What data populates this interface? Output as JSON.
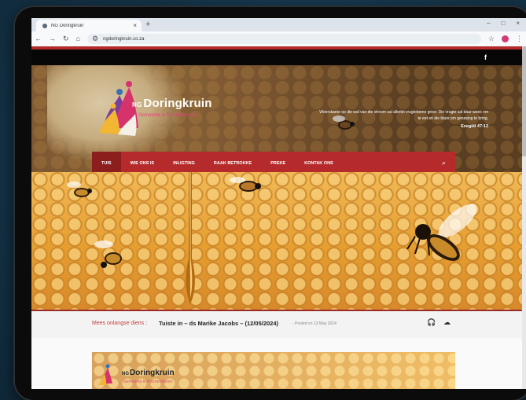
{
  "browser": {
    "tab_title": "NG Doringkruin",
    "url": "ngdoringkruin.co.za",
    "new_tab": "+",
    "tab_close": "×",
    "window_controls": [
      "–",
      "□",
      "×"
    ]
  },
  "site": {
    "facebook": "f",
    "logo_ng": "NG",
    "logo_name": "Doringkruin",
    "logo_subtitle": "Gemeente in Potchefstroom",
    "verse_text": "Weerskante op die wal van die stroom sal allerlei vrugtebome groei. Die vrugte sal daar wees om te eet en die blare om genesing te bring.",
    "verse_ref": "Esegiël 47:12",
    "nav": [
      "TUIS",
      "WIE ONS IS",
      "INLIGTING",
      "RAAK BETROKKE",
      "PREKE",
      "KONTAK ONS"
    ],
    "latest_label": "Mees onlangse diens :",
    "latest_title": "Tuiste in – ds Marike Jacobs – (12/05/2024)",
    "latest_date": "- Posted on 13 May 2024",
    "card_logo_ng": "NG",
    "card_logo_name": "Doringkruin",
    "card_logo_subtitle": "Gemeente in Potchefstroom"
  },
  "icons": [
    "shield-icon",
    "back-icon",
    "forward-icon",
    "reload-icon",
    "home-icon",
    "site-settings-icon",
    "star-icon",
    "profile-avatar",
    "menu-icon",
    "facebook-icon",
    "search-icon",
    "headphones-icon",
    "cloud-download-icon"
  ],
  "colors": {
    "brand_red": "#b52a2a",
    "accent_pink": "#e0457e",
    "honey": "#e59e2f"
  }
}
